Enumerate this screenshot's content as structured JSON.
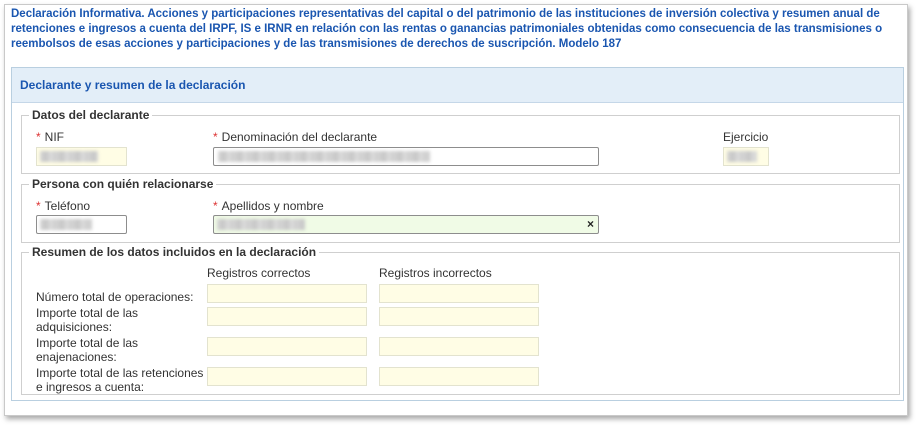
{
  "page": {
    "title": "Declaración Informativa. Acciones y participaciones representativas del capital o del patrimonio de las instituciones de inversión colectiva y resumen anual de retenciones e ingresos a cuenta del IRPF, IS e IRNR en relación con las rentas o ganancias patrimoniales obtenidas como consecuencia de las transmisiones o reembolsos de esas acciones y participaciones y de las transmisiones de derechos de suscripción. Modelo 187"
  },
  "panel": {
    "header": "Declarante y resumen de la declaración"
  },
  "declarante": {
    "legend": "Datos del declarante",
    "required_mark": "*",
    "nif_label": "NIF",
    "denominacion_label": "Denominación del declarante",
    "ejercicio_label": "Ejercicio"
  },
  "persona": {
    "legend": "Persona con quién relacionarse",
    "required_mark": "*",
    "telefono_label": "Teléfono",
    "apellidos_label": "Apellidos y nombre",
    "clear_icon": "×"
  },
  "resumen": {
    "legend": "Resumen de los datos incluidos en la declaración",
    "col_correctos": "Registros correctos",
    "col_incorrectos": "Registros incorrectos",
    "rows": [
      {
        "label": "Número total de operaciones:"
      },
      {
        "label": "Importe total de las adquisiciones:"
      },
      {
        "label": "Importe total de las enajenaciones:"
      },
      {
        "label": "Importe total de las retenciones e ingresos a cuenta:"
      }
    ]
  }
}
